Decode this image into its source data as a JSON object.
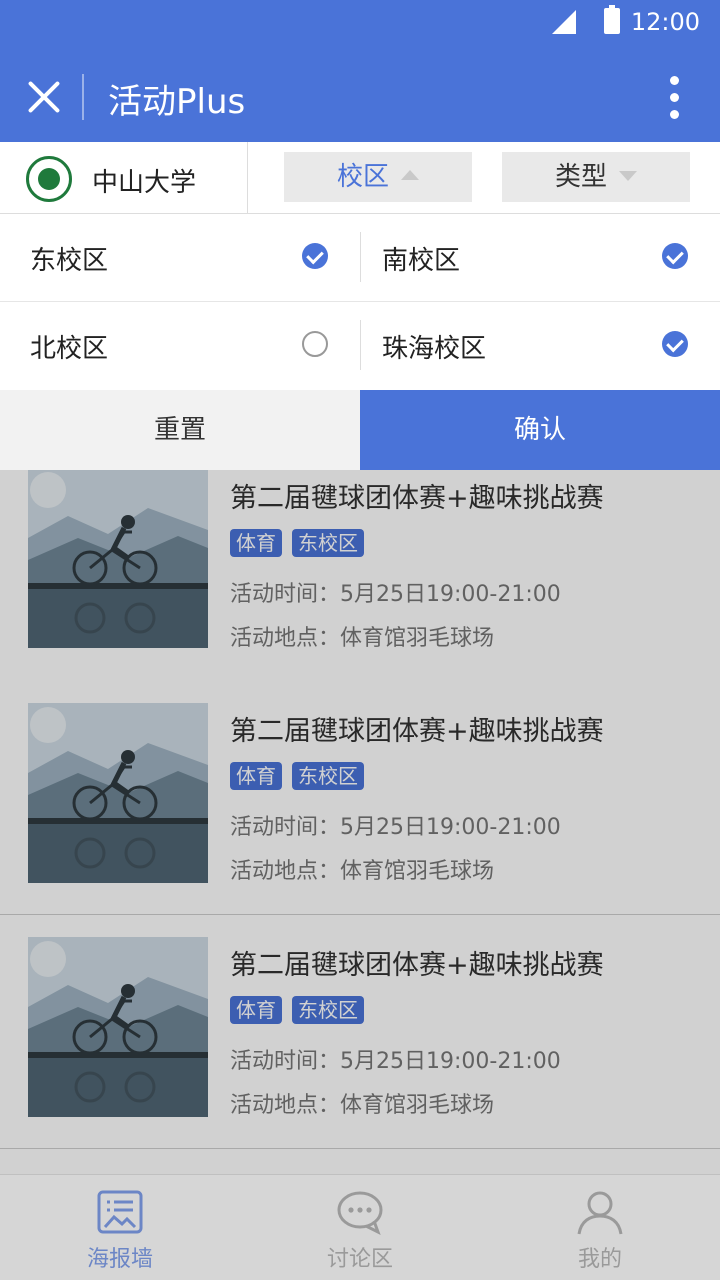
{
  "status": {
    "time": "12:00"
  },
  "appbar": {
    "title": "活动Plus"
  },
  "filter": {
    "school_name": "中山大学",
    "campus_label": "校区",
    "type_label": "类型"
  },
  "campus_options": [
    {
      "label": "东校区",
      "checked": true
    },
    {
      "label": "南校区",
      "checked": true
    },
    {
      "label": "北校区",
      "checked": false
    },
    {
      "label": "珠海校区",
      "checked": true
    }
  ],
  "actions": {
    "reset": "重置",
    "confirm": "确认"
  },
  "events": [
    {
      "title": "第二届毽球团体赛+趣味挑战赛",
      "tags": [
        "体育",
        "东校区"
      ],
      "time": "活动时间：5月25日19:00-21:00",
      "place": "活动地点：体育馆羽毛球场"
    },
    {
      "title": "第二届毽球团体赛+趣味挑战赛",
      "tags": [
        "体育",
        "东校区"
      ],
      "time": "活动时间：5月25日19:00-21:00",
      "place": "活动地点：体育馆羽毛球场"
    },
    {
      "title": "第二届毽球团体赛+趣味挑战赛",
      "tags": [
        "体育",
        "东校区"
      ],
      "time": "活动时间：5月25日19:00-21:00",
      "place": "活动地点：体育馆羽毛球场"
    }
  ],
  "tabs": [
    {
      "label": "海报墙",
      "icon": "poster-icon",
      "active": true
    },
    {
      "label": "讨论区",
      "icon": "chat-icon",
      "active": false
    },
    {
      "label": "我的",
      "icon": "user-icon",
      "active": false
    }
  ],
  "colors": {
    "primary": "#4a73d8",
    "tag": "#4a73d8"
  }
}
